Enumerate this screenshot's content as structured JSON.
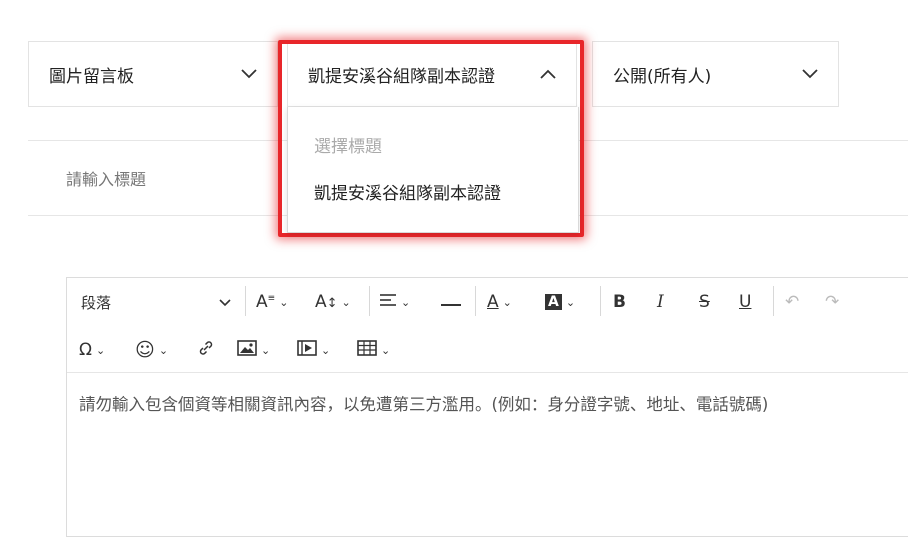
{
  "selects": {
    "board": {
      "value": "圖片留言板"
    },
    "title": {
      "value": "凱提安溪谷組隊副本認證",
      "placeholder": "選擇標題",
      "options": [
        "凱提安溪谷組隊副本認證"
      ]
    },
    "visibility": {
      "value": "公開(所有人)"
    }
  },
  "title_input": {
    "placeholder": "請輸入標題"
  },
  "editor": {
    "paragraph_style": "段落",
    "body_placeholder": "請勿輸入包含個資等相關資訊內容，以免遭第三方濫用。(例如：身分證字號、地址、電話號碼)"
  },
  "colors": {
    "highlight": "#e8262a"
  }
}
